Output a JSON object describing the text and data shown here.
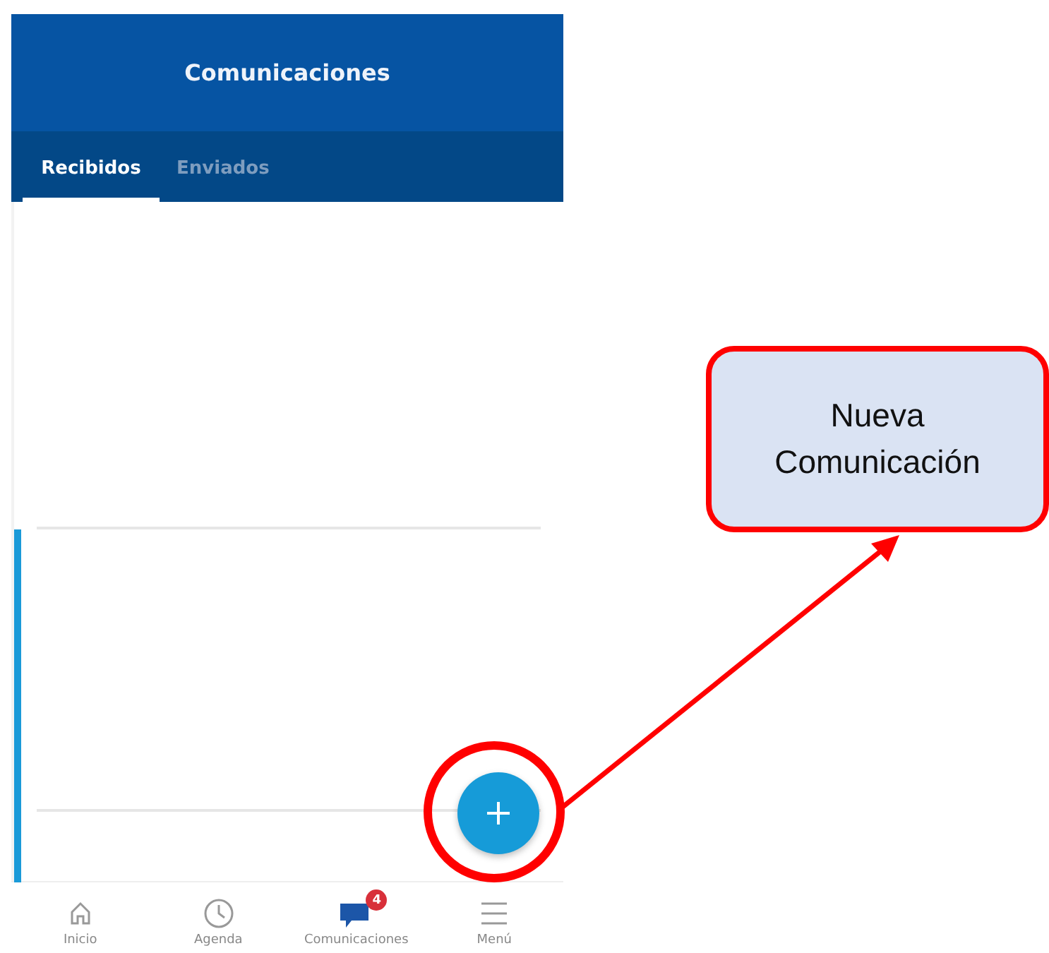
{
  "header": {
    "title": "Comunicaciones"
  },
  "tabs": [
    {
      "label": "Recibidos",
      "selected": true
    },
    {
      "label": "Enviados",
      "selected": false
    }
  ],
  "bottom_nav": [
    {
      "kind": "home",
      "label": "Inicio",
      "selected": false
    },
    {
      "kind": "clock",
      "label": "Agenda",
      "selected": false
    },
    {
      "kind": "chat",
      "label": "Comunicaciones",
      "selected": true,
      "badge": "4"
    },
    {
      "kind": "menu",
      "label": "Menú",
      "selected": false
    }
  ],
  "callout": {
    "text": "Nueva Comunicación"
  }
}
